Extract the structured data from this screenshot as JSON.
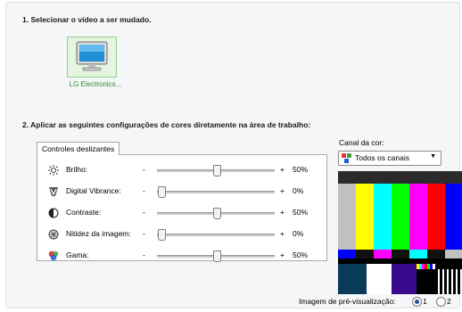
{
  "section1": {
    "heading": "1. Selecionar o vídeo a ser mudado."
  },
  "display": {
    "label": "LG Electronics..."
  },
  "section2": {
    "heading": "2. Aplicar as seguintes configurações de cores diretamente na área de trabalho:"
  },
  "group": {
    "tab": "Controles deslizantes",
    "sliders": [
      {
        "label": "Brilho:",
        "minus": "-",
        "plus": "+",
        "value": "50%",
        "level": 0.5,
        "icon": "brightness-icon"
      },
      {
        "label": "Digital Vibrance:",
        "minus": "-",
        "plus": "+",
        "value": "0%",
        "level": 0.0,
        "icon": "vibrance-icon"
      },
      {
        "label": "Contraste:",
        "minus": "-",
        "plus": "+",
        "value": "50%",
        "level": 0.5,
        "icon": "contrast-icon"
      },
      {
        "label": "Nitidez da imagem:",
        "minus": "-",
        "plus": "+",
        "value": "0%",
        "level": 0.0,
        "icon": "sharpness-icon"
      },
      {
        "label": "Gama:",
        "minus": "-",
        "plus": "+",
        "value": "50%",
        "level": 0.5,
        "icon": "gamma-icon"
      }
    ]
  },
  "channel": {
    "label": "Canal da cor:",
    "selected": "Todos os canais"
  },
  "preview": {
    "label": "Imagem de pré-visualização:",
    "options": [
      "1",
      "2"
    ],
    "selected": "1",
    "bars": [
      "#c0c0c0",
      "#ffff00",
      "#00ffff",
      "#00ff00",
      "#ff00ff",
      "#ff0000",
      "#0000ff"
    ],
    "row2": [
      "#0000ff",
      "#111111",
      "#ff00ff",
      "#111111",
      "#00ffff",
      "#111111",
      "#c0c0c0"
    ],
    "row3": [
      "#0a3c5a",
      "#ffffff",
      "#3a0a8c",
      "#000000"
    ]
  }
}
